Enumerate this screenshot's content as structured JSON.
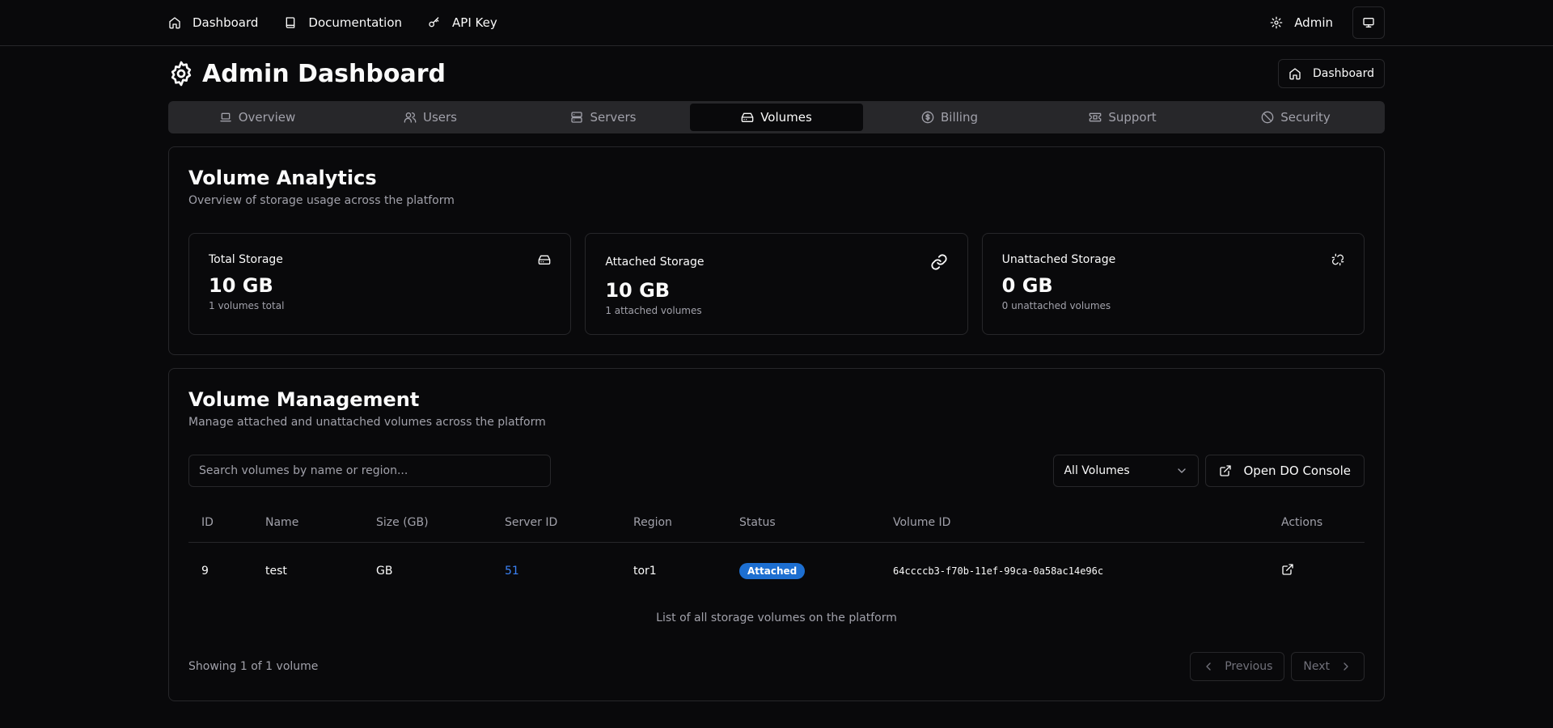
{
  "topnav": {
    "items": [
      {
        "label": "Dashboard",
        "icon": "home-icon"
      },
      {
        "label": "Documentation",
        "icon": "book-icon"
      },
      {
        "label": "API Key",
        "icon": "key-icon"
      }
    ],
    "admin_label": "Admin",
    "theme_icon": "monitor-icon"
  },
  "header": {
    "title": "Admin Dashboard",
    "dashboard_button": "Dashboard"
  },
  "tabs": [
    {
      "label": "Overview",
      "active": false
    },
    {
      "label": "Users",
      "active": false
    },
    {
      "label": "Servers",
      "active": false
    },
    {
      "label": "Volumes",
      "active": true
    },
    {
      "label": "Billing",
      "active": false
    },
    {
      "label": "Support",
      "active": false
    },
    {
      "label": "Security",
      "active": false
    }
  ],
  "analytics": {
    "title": "Volume Analytics",
    "description": "Overview of storage usage across the platform",
    "stats": [
      {
        "label": "Total Storage",
        "value": "10 GB",
        "sub": "1 volumes total",
        "icon": "hard-drive-icon"
      },
      {
        "label": "Attached Storage",
        "value": "10 GB",
        "sub": "1 attached volumes",
        "icon": "link-icon"
      },
      {
        "label": "Unattached Storage",
        "value": "0 GB",
        "sub": "0 unattached volumes",
        "icon": "unlink-icon"
      }
    ]
  },
  "management": {
    "title": "Volume Management",
    "description": "Manage attached and unattached volumes across the platform",
    "search_placeholder": "Search volumes by name or region...",
    "filter_value": "All Volumes",
    "console_button": "Open DO Console",
    "columns": [
      "ID",
      "Name",
      "Size (GB)",
      "Server ID",
      "Region",
      "Status",
      "Volume ID",
      "Actions"
    ],
    "rows": [
      {
        "id": "9",
        "name": "test",
        "size": "GB",
        "server_id": "51",
        "region": "tor1",
        "status": "Attached",
        "volume_id": "64ccccb3-f70b-11ef-99ca-0a58ac14e96c"
      }
    ],
    "caption": "List of all storage volumes on the platform",
    "pager_info": "Showing 1 of 1 volume",
    "prev_label": "Previous",
    "next_label": "Next"
  },
  "colors": {
    "background": "#09090b",
    "border": "#27272a",
    "muted": "#a1a1aa",
    "badge": "#1d6fd1",
    "link": "#3b82f6"
  }
}
